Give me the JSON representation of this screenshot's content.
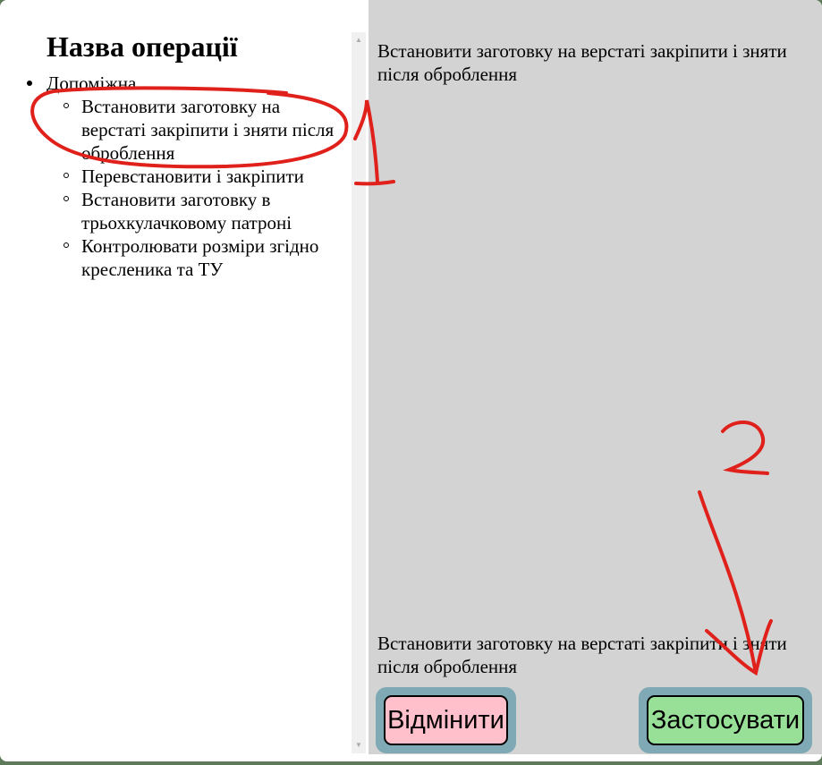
{
  "dialog": {
    "title": "Назва операції",
    "group": {
      "label": "Допоміжна",
      "items": [
        {
          "label": "Встановити заготовку на верстаті закріпити і зняти після оброблення"
        },
        {
          "label": "Перевстановити і закріпити"
        },
        {
          "label": "Встановити заготовку в трьохкулачковому патроні"
        },
        {
          "label": "Контролювати розміри згідно кресленика та ТУ"
        }
      ]
    },
    "preview_text": "Встановити заготовку на верстаті закріпити і зняти після оброблення",
    "result_text": "Встановити заготовку на верстаті закріпити і зняти після оброблення",
    "buttons": {
      "cancel": "Відмінити",
      "apply": "Застосувати"
    },
    "colors": {
      "cancel_bg": "#ffc0cb",
      "apply_bg": "#98e098",
      "button_border": "#7fa9b5",
      "right_pane_bg": "#d3d3d3",
      "annotation": "#e0201a"
    }
  }
}
